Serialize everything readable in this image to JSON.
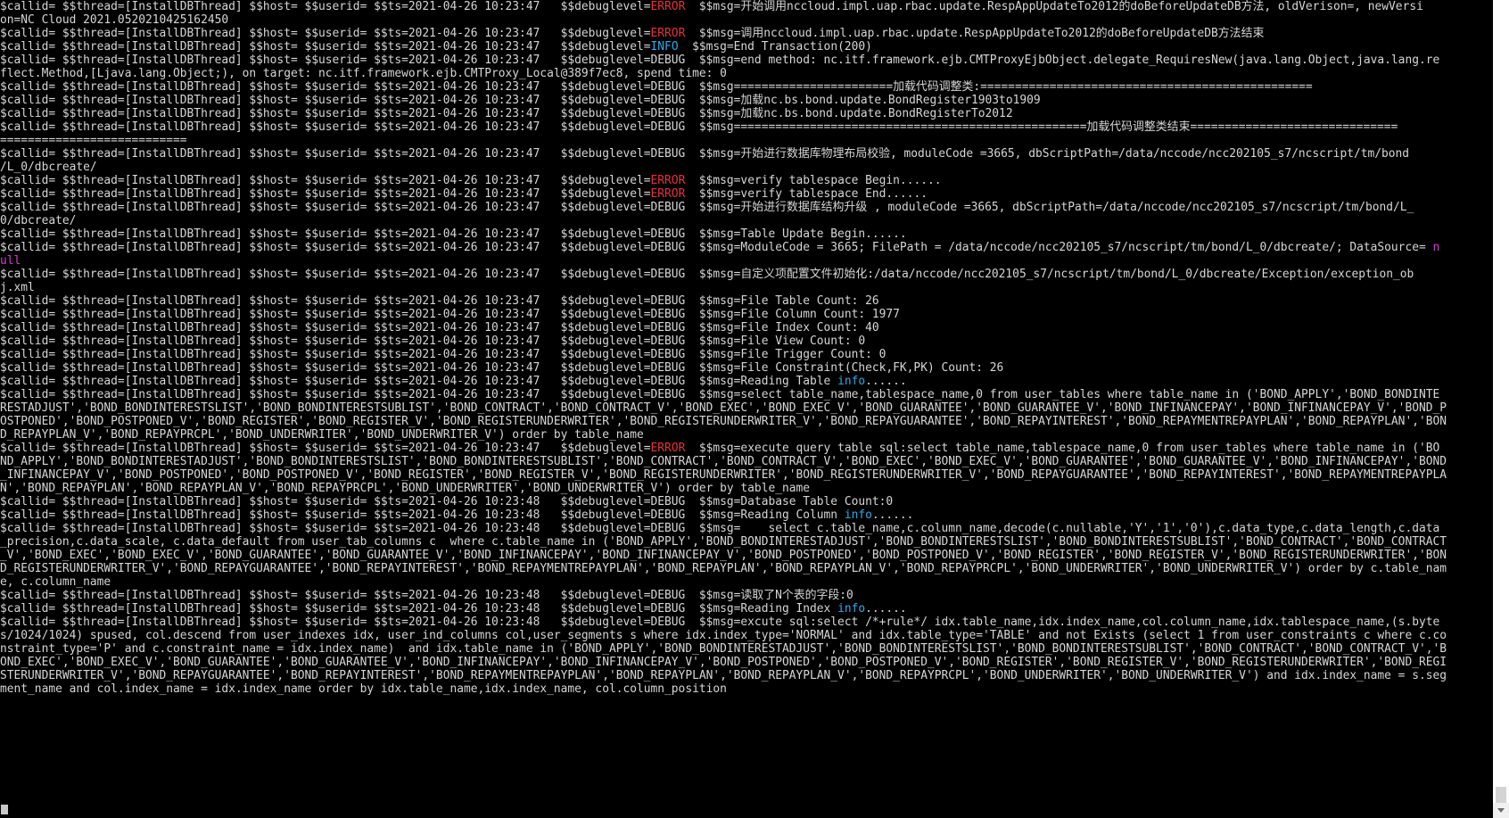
{
  "colors": {
    "background": "#000000",
    "text": "#d6d6d6",
    "error": "#e5323a",
    "info": "#2fa9e6",
    "null": "#d33fd3",
    "scrollbar": "#ffffff"
  },
  "terminal": {
    "lines": [
      [
        [
          "$callid= $$thread=[InstallDBThread] $$host= $$userid= $$ts=2021-04-26 10:23:47   $$debuglevel=",
          "default"
        ],
        [
          "ERROR",
          "error"
        ],
        [
          "  $$msg=开始调用nccloud.impl.uap.rbac.update.RespAppUpdateTo2012的doBeforeUpdateDB方法, oldVerison=, newVersi",
          "default"
        ]
      ],
      [
        [
          "on=NC Cloud 2021.0520210425162450",
          "default"
        ]
      ],
      [
        [
          "$callid= $$thread=[InstallDBThread] $$host= $$userid= $$ts=2021-04-26 10:23:47   $$debuglevel=",
          "default"
        ],
        [
          "ERROR",
          "error"
        ],
        [
          "  $$msg=调用nccloud.impl.uap.rbac.update.RespAppUpdateTo2012的doBeforeUpdateDB方法结束",
          "default"
        ]
      ],
      [
        [
          "$callid= $$thread=[InstallDBThread] $$host= $$userid= $$ts=2021-04-26 10:23:47   $$debuglevel=",
          "default"
        ],
        [
          "INFO",
          "info"
        ],
        [
          "  $$msg=End Transaction(200)",
          "default"
        ]
      ],
      [
        [
          "$callid= $$thread=[InstallDBThread] $$host= $$userid= $$ts=2021-04-26 10:23:47   $$debuglevel=DEBUG  $$msg=end method: nc.itf.framework.ejb.CMTProxyEjbObject.delegate_RequiresNew(java.lang.Object,java.lang.re",
          "default"
        ]
      ],
      [
        [
          "flect.Method,[Ljava.lang.Object;), on target: nc.itf.framework.ejb.CMTProxy_Local@389f7ec8, spend time: 0",
          "default"
        ]
      ],
      [
        [
          "$callid= $$thread=[InstallDBThread] $$host= $$userid= $$ts=2021-04-26 10:23:47   $$debuglevel=DEBUG  $$msg=======================加载代码调整类:================================================",
          "default"
        ]
      ],
      [
        [
          "$callid= $$thread=[InstallDBThread] $$host= $$userid= $$ts=2021-04-26 10:23:47   $$debuglevel=DEBUG  $$msg=加载nc.bs.bond.update.BondRegister1903to1909",
          "default"
        ]
      ],
      [
        [
          "$callid= $$thread=[InstallDBThread] $$host= $$userid= $$ts=2021-04-26 10:23:47   $$debuglevel=DEBUG  $$msg=加载nc.bs.bond.update.BondRegisterTo2012",
          "default"
        ]
      ],
      [
        [
          "$callid= $$thread=[InstallDBThread] $$host= $$userid= $$ts=2021-04-26 10:23:47   $$debuglevel=DEBUG  $$msg===================================================加载代码调整类结束==============================",
          "default"
        ]
      ],
      [
        [
          "===========================",
          "default"
        ]
      ],
      [
        [
          "$callid= $$thread=[InstallDBThread] $$host= $$userid= $$ts=2021-04-26 10:23:47   $$debuglevel=DEBUG  $$msg=开始进行数据库物理布局校验, moduleCode =3665, dbScriptPath=/data/nccode/ncc202105_s7/ncscript/tm/bond",
          "default"
        ]
      ],
      [
        [
          "/L_0/dbcreate/",
          "default"
        ]
      ],
      [
        [
          "$callid= $$thread=[InstallDBThread] $$host= $$userid= $$ts=2021-04-26 10:23:47   $$debuglevel=",
          "default"
        ],
        [
          "ERROR",
          "error"
        ],
        [
          "  $$msg=verify tablespace Begin......",
          "default"
        ]
      ],
      [
        [
          "$callid= $$thread=[InstallDBThread] $$host= $$userid= $$ts=2021-04-26 10:23:47   $$debuglevel=",
          "default"
        ],
        [
          "ERROR",
          "error"
        ],
        [
          "  $$msg=verify tablespace End......",
          "default"
        ]
      ],
      [
        [
          "$callid= $$thread=[InstallDBThread] $$host= $$userid= $$ts=2021-04-26 10:23:47   $$debuglevel=DEBUG  $$msg=开始进行数据库结构升级 , moduleCode =3665, dbScriptPath=/data/nccode/ncc202105_s7/ncscript/tm/bond/L_",
          "default"
        ]
      ],
      [
        [
          "0/dbcreate/",
          "default"
        ]
      ],
      [
        [
          "$callid= $$thread=[InstallDBThread] $$host= $$userid= $$ts=2021-04-26 10:23:47   $$debuglevel=DEBUG  $$msg=Table Update Begin......",
          "default"
        ]
      ],
      [
        [
          "$callid= $$thread=[InstallDBThread] $$host= $$userid= $$ts=2021-04-26 10:23:47   $$debuglevel=DEBUG  $$msg=ModuleCode = 3665; FilePath = /data/nccode/ncc202105_s7/ncscript/tm/bond/L_0/dbcreate/; DataSource= ",
          "default"
        ],
        [
          "n",
          "magenta"
        ]
      ],
      [
        [
          "ull",
          "magenta"
        ]
      ],
      [
        [
          "$callid= $$thread=[InstallDBThread] $$host= $$userid= $$ts=2021-04-26 10:23:47   $$debuglevel=DEBUG  $$msg=自定义项配置文件初始化:/data/nccode/ncc202105_s7/ncscript/tm/bond/L_0/dbcreate/Exception/exception_ob",
          "default"
        ]
      ],
      [
        [
          "j.xml",
          "default"
        ]
      ],
      [
        [
          "$callid= $$thread=[InstallDBThread] $$host= $$userid= $$ts=2021-04-26 10:23:47   $$debuglevel=DEBUG  $$msg=File Table Count: 26",
          "default"
        ]
      ],
      [
        [
          "$callid= $$thread=[InstallDBThread] $$host= $$userid= $$ts=2021-04-26 10:23:47   $$debuglevel=DEBUG  $$msg=File Column Count: 1977",
          "default"
        ]
      ],
      [
        [
          "$callid= $$thread=[InstallDBThread] $$host= $$userid= $$ts=2021-04-26 10:23:47   $$debuglevel=DEBUG  $$msg=File Index Count: 40",
          "default"
        ]
      ],
      [
        [
          "$callid= $$thread=[InstallDBThread] $$host= $$userid= $$ts=2021-04-26 10:23:47   $$debuglevel=DEBUG  $$msg=File View Count: 0",
          "default"
        ]
      ],
      [
        [
          "$callid= $$thread=[InstallDBThread] $$host= $$userid= $$ts=2021-04-26 10:23:47   $$debuglevel=DEBUG  $$msg=File Trigger Count: 0",
          "default"
        ]
      ],
      [
        [
          "$callid= $$thread=[InstallDBThread] $$host= $$userid= $$ts=2021-04-26 10:23:47   $$debuglevel=DEBUG  $$msg=File Constraint(Check,FK,PK) Count: 26",
          "default"
        ]
      ],
      [
        [
          "$callid= $$thread=[InstallDBThread] $$host= $$userid= $$ts=2021-04-26 10:23:47   $$debuglevel=DEBUG  $$msg=Reading Table ",
          "default"
        ],
        [
          "info",
          "info"
        ],
        [
          "......",
          "default"
        ]
      ],
      [
        [
          "$callid= $$thread=[InstallDBThread] $$host= $$userid= $$ts=2021-04-26 10:23:47   $$debuglevel=DEBUG  $$msg=select table_name,tablespace_name,0 from user_tables where table_name in ('BOND_APPLY','BOND_BONDINTE",
          "default"
        ]
      ],
      [
        [
          "RESTADJUST','BOND_BONDINTERESTSLIST','BOND_BONDINTERESTSUBLIST','BOND_CONTRACT','BOND_CONTRACT_V','BOND_EXEC','BOND_EXEC_V','BOND_GUARANTEE','BOND_GUARANTEE_V','BOND_INFINANCEPAY','BOND_INFINANCEPAY_V','BOND_P",
          "default"
        ]
      ],
      [
        [
          "OSTPONED','BOND_POSTPONED_V','BOND_REGISTER','BOND_REGISTER_V','BOND_REGISTERUNDERWRITER','BOND_REGISTERUNDERWRITER_V','BOND_REPAYGUARANTEE','BOND_REPAYINTEREST','BOND_REPAYMENTREPAYPLAN','BOND_REPAYPLAN','BON",
          "default"
        ]
      ],
      [
        [
          "D_REPAYPLAN_V','BOND_REPAYPRCPL','BOND_UNDERWRITER','BOND_UNDERWRITER_V') order by table_name",
          "default"
        ]
      ],
      [
        [
          "$callid= $$thread=[InstallDBThread] $$host= $$userid= $$ts=2021-04-26 10:23:47   $$debuglevel=",
          "default"
        ],
        [
          "ERROR",
          "error"
        ],
        [
          "  $$msg=execute query table sql:select table_name,tablespace_name,0 from user_tables where table_name in ('BO",
          "default"
        ]
      ],
      [
        [
          "ND_APPLY','BOND_BONDINTERESTADJUST','BOND_BONDINTERESTSLIST','BOND_BONDINTERESTSUBLIST','BOND_CONTRACT','BOND_CONTRACT_V','BOND_EXEC','BOND_EXEC_V','BOND_GUARANTEE','BOND_GUARANTEE_V','BOND_INFINANCEPAY','BOND",
          "default"
        ]
      ],
      [
        [
          "_INFINANCEPAY_V','BOND_POSTPONED','BOND_POSTPONED_V','BOND_REGISTER','BOND_REGISTER_V','BOND_REGISTERUNDERWRITER','BOND_REGISTERUNDERWRITER_V','BOND_REPAYGUARANTEE','BOND_REPAYINTEREST','BOND_REPAYMENTREPAYPLA",
          "default"
        ]
      ],
      [
        [
          "N','BOND_REPAYPLAN','BOND_REPAYPLAN_V','BOND_REPAYPRCPL','BOND_UNDERWRITER','BOND_UNDERWRITER_V') order by table_name",
          "default"
        ]
      ],
      [
        [
          "$callid= $$thread=[InstallDBThread] $$host= $$userid= $$ts=2021-04-26 10:23:48   $$debuglevel=DEBUG  $$msg=Database Table Count:0",
          "default"
        ]
      ],
      [
        [
          "$callid= $$thread=[InstallDBThread] $$host= $$userid= $$ts=2021-04-26 10:23:48   $$debuglevel=DEBUG  $$msg=Reading Column ",
          "default"
        ],
        [
          "info",
          "info"
        ],
        [
          "......",
          "default"
        ]
      ],
      [
        [
          "$callid= $$thread=[InstallDBThread] $$host= $$userid= $$ts=2021-04-26 10:23:48   $$debuglevel=DEBUG  $$msg=    select c.table_name,c.column_name,decode(c.nullable,'Y','1','0'),c.data_type,c.data_length,c.data",
          "default"
        ]
      ],
      [
        [
          "_precision,c.data_scale, c.data_default from user_tab_columns c  where c.table_name in ('BOND_APPLY','BOND_BONDINTERESTADJUST','BOND_BONDINTERESTSLIST','BOND_BONDINTERESTSUBLIST','BOND_CONTRACT','BOND_CONTRACT",
          "default"
        ]
      ],
      [
        [
          "_V','BOND_EXEC','BOND_EXEC_V','BOND_GUARANTEE','BOND_GUARANTEE_V','BOND_INFINANCEPAY','BOND_INFINANCEPAY_V','BOND_POSTPONED','BOND_POSTPONED_V','BOND_REGISTER','BOND_REGISTER_V','BOND_REGISTERUNDERWRITER','BON",
          "default"
        ]
      ],
      [
        [
          "D_REGISTERUNDERWRITER_V','BOND_REPAYGUARANTEE','BOND_REPAYINTEREST','BOND_REPAYMENTREPAYPLAN','BOND_REPAYPLAN','BOND_REPAYPLAN_V','BOND_REPAYPRCPL','BOND_UNDERWRITER','BOND_UNDERWRITER_V') order by c.table_nam",
          "default"
        ]
      ],
      [
        [
          "e, c.column_name",
          "default"
        ]
      ],
      [
        [
          "$callid= $$thread=[InstallDBThread] $$host= $$userid= $$ts=2021-04-26 10:23:48   $$debuglevel=DEBUG  $$msg=读取了N个表的字段:0",
          "default"
        ]
      ],
      [
        [
          "$callid= $$thread=[InstallDBThread] $$host= $$userid= $$ts=2021-04-26 10:23:48   $$debuglevel=DEBUG  $$msg=Reading Index ",
          "default"
        ],
        [
          "info",
          "info"
        ],
        [
          "......",
          "default"
        ]
      ],
      [
        [
          "$callid= $$thread=[InstallDBThread] $$host= $$userid= $$ts=2021-04-26 10:23:48   $$debuglevel=DEBUG  $$msg=excute sql:select /*+rule*/ idx.table_name,idx.index_name,col.column_name,idx.tablespace_name,(s.byte",
          "default"
        ]
      ],
      [
        [
          "s/1024/1024) spused, col.descend from user_indexes idx, user_ind_columns col,user_segments s where idx.index_type='NORMAL' and idx.table_type='TABLE' and not Exists (select 1 from user_constraints c where c.co",
          "default"
        ]
      ],
      [
        [
          "nstraint_type='P' and c.constraint_name = idx.index_name)  and idx.table_name in ('BOND_APPLY','BOND_BONDINTERESTADJUST','BOND_BONDINTERESTSLIST','BOND_BONDINTERESTSUBLIST','BOND_CONTRACT','BOND_CONTRACT_V','B",
          "default"
        ]
      ],
      [
        [
          "OND_EXEC','BOND_EXEC_V','BOND_GUARANTEE','BOND_GUARANTEE_V','BOND_INFINANCEPAY','BOND_INFINANCEPAY_V','BOND_POSTPONED','BOND_POSTPONED_V','BOND_REGISTER','BOND_REGISTER_V','BOND_REGISTERUNDERWRITER','BOND_REGI",
          "default"
        ]
      ],
      [
        [
          "STERUNDERWRITER_V','BOND_REPAYGUARANTEE','BOND_REPAYINTEREST','BOND_REPAYMENTREPAYPLAN','BOND_REPAYPLAN','BOND_REPAYPLAN_V','BOND_REPAYPRCPL','BOND_UNDERWRITER','BOND_UNDERWRITER_V') and idx.index_name = s.seg",
          "default"
        ]
      ],
      [
        [
          "ment_name and col.index_name = idx.index_name order by idx.table_name,idx.index_name, col.column_position",
          "default"
        ]
      ]
    ]
  }
}
